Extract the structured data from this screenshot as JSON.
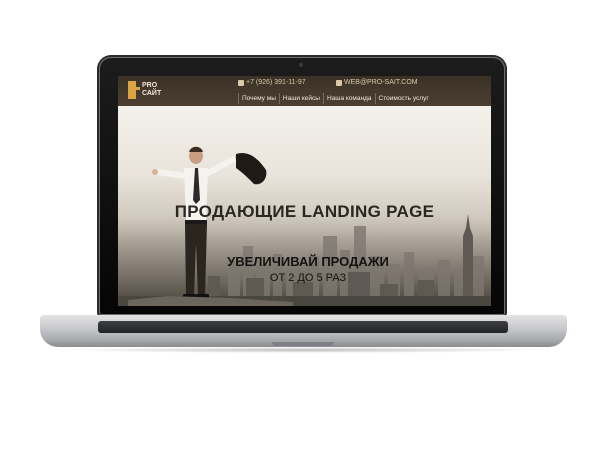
{
  "header": {
    "logo_line1": "PRO",
    "logo_line2": "САЙТ",
    "phone": "+7 (926) 391-11-97",
    "email": "WEB@PRO-SAIT.COM",
    "nav": [
      {
        "label": "Почему мы"
      },
      {
        "label": "Наши кейсы"
      },
      {
        "label": "Наша команда"
      },
      {
        "label": "Стоимость услуг"
      }
    ]
  },
  "hero": {
    "headline": "ПРОДАЮЩИЕ LANDING PAGE",
    "subline1": "УВЕЛИЧИВАЙ ПРОДАЖИ",
    "subline2": "ОТ 2 ДО 5 РАЗ"
  },
  "colors": {
    "accent": "#d9a441",
    "header_bg": "#3a3126",
    "nav_text": "#f2eadb"
  },
  "icons": [
    "phone-icon",
    "mail-icon"
  ]
}
